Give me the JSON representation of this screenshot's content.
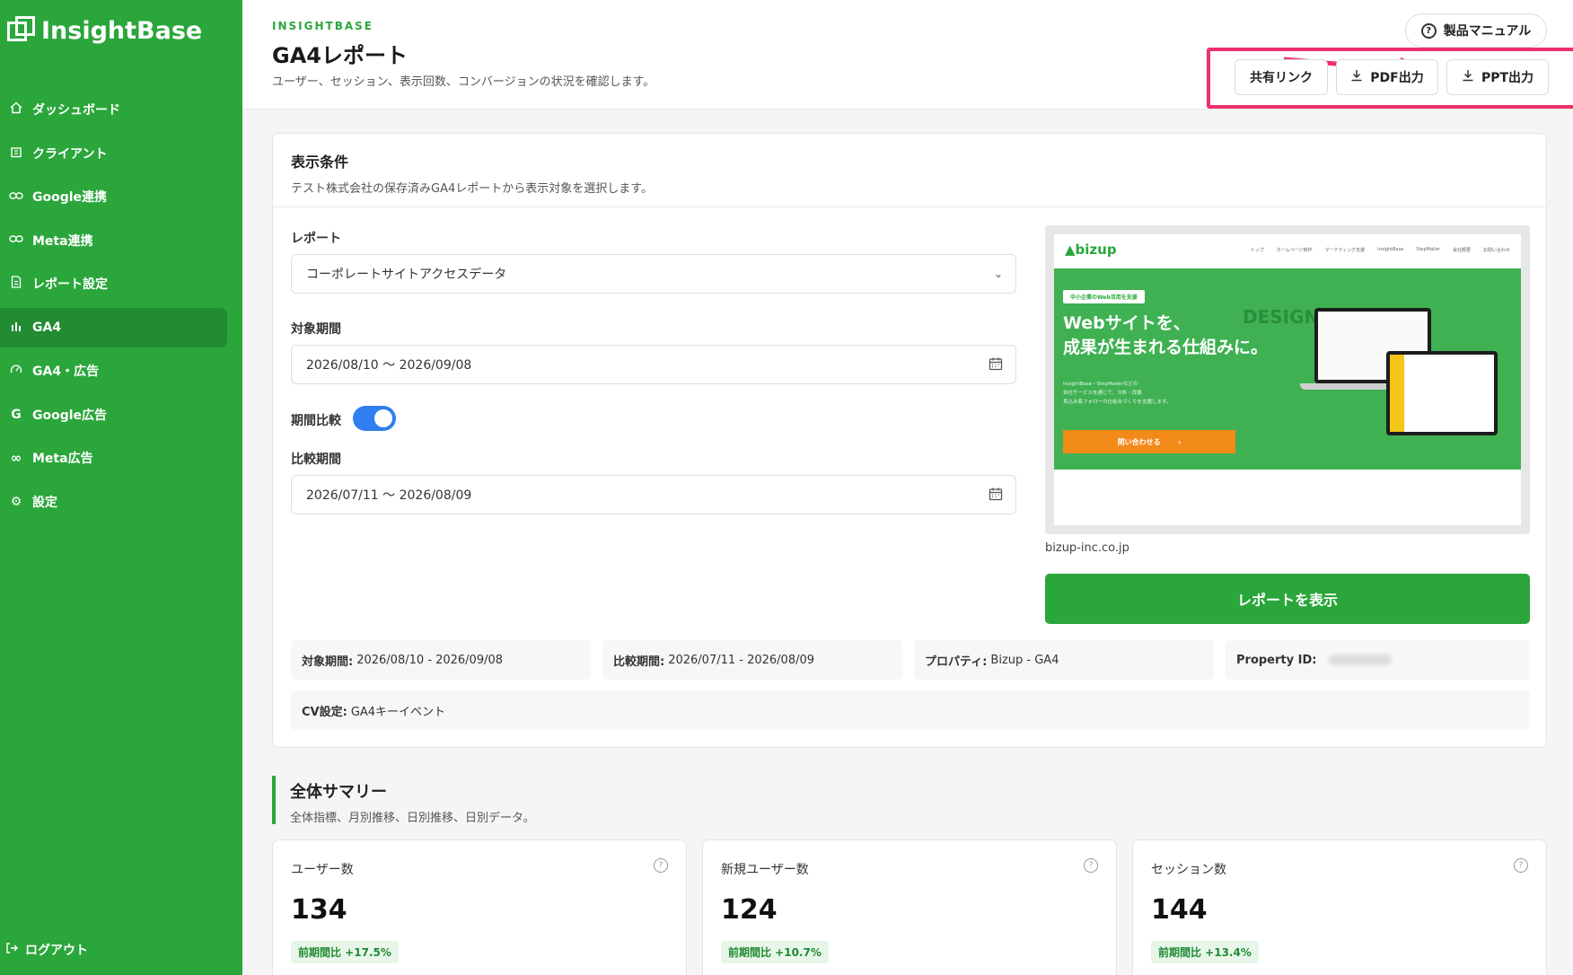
{
  "app": {
    "name": "InsightBase"
  },
  "sidebar": {
    "items": [
      {
        "label": "ダッシュボード",
        "icon": "home-icon"
      },
      {
        "label": "クライアント",
        "icon": "building-icon"
      },
      {
        "label": "Google連携",
        "icon": "link-icon"
      },
      {
        "label": "Meta連携",
        "icon": "link-icon"
      },
      {
        "label": "レポート設定",
        "icon": "document-icon"
      },
      {
        "label": "GA4",
        "icon": "bar-chart-icon",
        "active": true
      },
      {
        "label": "GA4・広告",
        "icon": "gauge-icon"
      },
      {
        "label": "Google広告",
        "icon": "google-g-icon"
      },
      {
        "label": "Meta広告",
        "icon": "meta-infinity-icon"
      },
      {
        "label": "設定",
        "icon": "gear-icon"
      }
    ],
    "logout": "ログアウト"
  },
  "header": {
    "brand": "INSIGHTBASE",
    "title": "GA4レポート",
    "subtitle": "ユーザー、セッション、表示回数、コンバージョンの状況を確認します。",
    "manual": "製品マニュアル",
    "share": "共有リンク",
    "pdf": "PDF出力",
    "ppt": "PPT出力"
  },
  "conditions": {
    "title": "表示条件",
    "subtitle": "テスト株式会社の保存済みGA4レポートから表示対象を選択します。",
    "report_label": "レポート",
    "report_value": "コーポレートサイトアクセスデータ",
    "period_label": "対象期間",
    "period_value": "2026/08/10 〜 2026/09/08",
    "compare_toggle_label": "期間比較",
    "compare_enabled": true,
    "compare_label": "比較期間",
    "compare_value": "2026/07/11 〜 2026/08/09",
    "preview": {
      "logo": "bizup",
      "nav_links": [
        "トップ",
        "ホームページ制作",
        "マーケティング支援",
        "InsightBase",
        "StepMailer",
        "会社概要",
        "お問い合わせ"
      ],
      "pill": "中小企業のWeb活用を支援",
      "headline_1": "Webサイトを、",
      "headline_2": "成果が生まれる仕組みに。",
      "body_1": "InsightBase・StepMailerなどの",
      "body_2": "自社サービスを通じて、分析・改善",
      "body_3": "見込み客フォローの仕組みづくりを支援します。",
      "cta": "問い合わせる",
      "design_word": "DESIGN"
    },
    "domain": "bizup-inc.co.jp",
    "show_button": "レポートを表示",
    "meta": {
      "period_key": "対象期間:",
      "period_val": "2026/08/10 - 2026/09/08",
      "compare_key": "比較期間:",
      "compare_val": "2026/07/11 - 2026/08/09",
      "property_key": "プロパティ:",
      "property_val": "Bizup - GA4",
      "property_id_key": "Property ID:",
      "cv_key": "CV設定:",
      "cv_val": "GA4キーイベント"
    }
  },
  "summary": {
    "title": "全体サマリー",
    "subtitle": "全体指標、月別推移、日別推移、日別データ。",
    "kpis": [
      {
        "label": "ユーザー数",
        "value": "134",
        "delta": "前期間比 +17.5%"
      },
      {
        "label": "新規ユーザー数",
        "value": "124",
        "delta": "前期間比 +10.7%"
      },
      {
        "label": "セッション数",
        "value": "144",
        "delta": "前期間比 +13.4%"
      }
    ]
  },
  "colors": {
    "brand": "#2aa63b",
    "highlight": "#f0306b",
    "toggle": "#2f7ff0"
  }
}
